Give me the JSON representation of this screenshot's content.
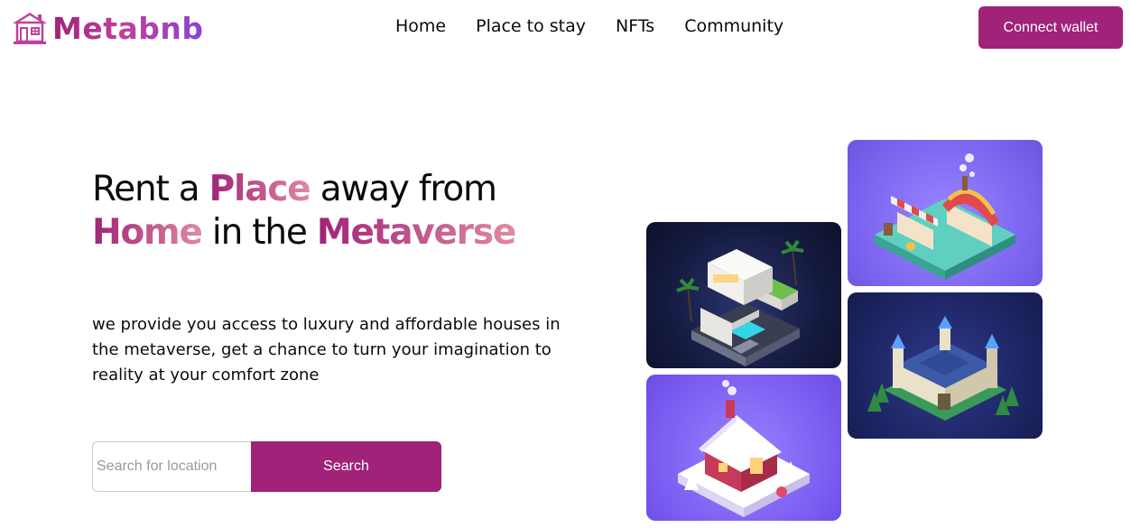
{
  "brand": {
    "name": "Metabnb",
    "icon": "house-icon",
    "gradient": [
      "#a02279",
      "#8a44d4"
    ]
  },
  "nav": {
    "items": [
      {
        "label": "Home"
      },
      {
        "label": "Place to stay"
      },
      {
        "label": "NFTs"
      },
      {
        "label": "Community"
      }
    ]
  },
  "header": {
    "connect_label": "Connect wallet"
  },
  "hero": {
    "title_1": "Rent a ",
    "title_2": "Place",
    "title_3": " away from ",
    "title_4": "Home",
    "title_5": " in the ",
    "title_6": "Metaverse",
    "description": "we provide you access to luxury and affordable houses in the metaverse, get a chance to turn your imagination to reality at your comfort zone"
  },
  "search": {
    "placeholder": "Search for location",
    "button_label": "Search"
  },
  "gallery": {
    "tiles": [
      {
        "name": "modern-villa-image"
      },
      {
        "name": "market-stall-image"
      },
      {
        "name": "snowy-cottage-image"
      },
      {
        "name": "castle-image"
      }
    ]
  },
  "colors": {
    "accent": "#a02279",
    "accent_light": "#e08aa0",
    "text": "#0b0b0b"
  }
}
